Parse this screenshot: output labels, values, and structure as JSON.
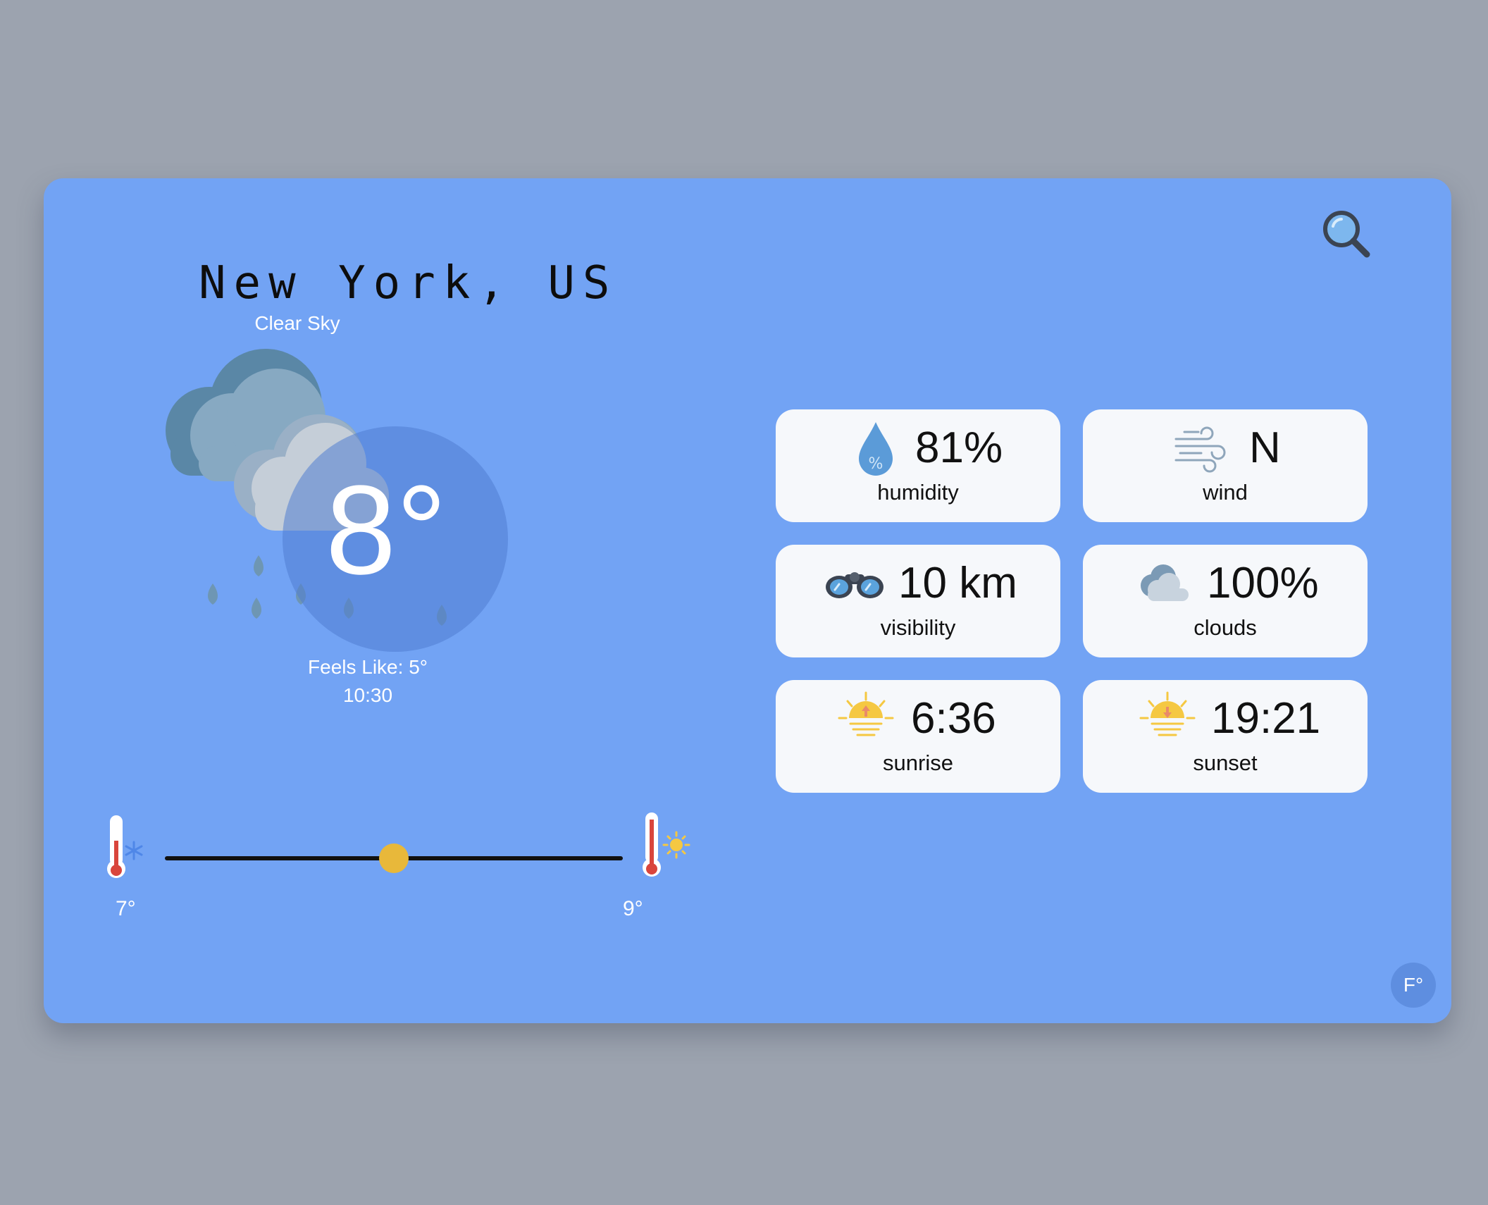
{
  "location": {
    "city": "New York, US",
    "condition": "Clear Sky"
  },
  "current": {
    "temperature": "8°",
    "feels_like": "Feels Like: 5°",
    "time": "10:30",
    "icon": "cloud-rain-icon"
  },
  "range": {
    "min_label": "7°",
    "max_label": "9°",
    "current_fraction": 0.5
  },
  "stats": [
    {
      "value": "81%",
      "label": "humidity",
      "icon": "humidity-drop-icon"
    },
    {
      "value": "N",
      "label": "wind",
      "icon": "wind-icon"
    },
    {
      "value": "10 km",
      "label": "visibility",
      "icon": "binoculars-icon"
    },
    {
      "value": "100%",
      "label": "clouds",
      "icon": "cloud-icon"
    },
    {
      "value": "6:36",
      "label": "sunrise",
      "icon": "sunrise-icon"
    },
    {
      "value": "19:21",
      "label": "sunset",
      "icon": "sunset-icon"
    }
  ],
  "controls": {
    "unit_toggle": "F°",
    "search_icon": "search-icon"
  },
  "colors": {
    "background": "#9ca3af",
    "card": "#72a3f4",
    "tile": "#f6f8fb",
    "knob": "#e8b83a",
    "sun": "#f5c842"
  }
}
